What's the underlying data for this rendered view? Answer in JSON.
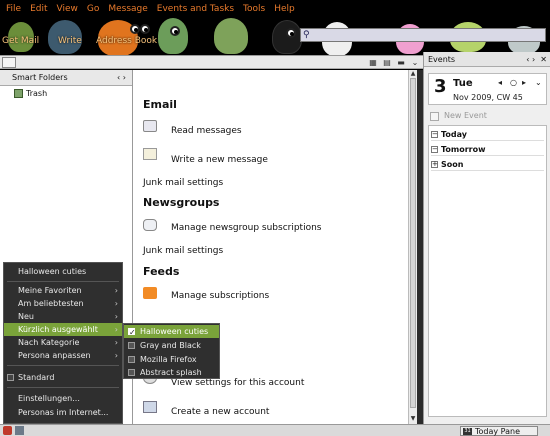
{
  "menubar": {
    "items": [
      "File",
      "Edit",
      "View",
      "Go",
      "Message",
      "Events and Tasks",
      "Tools",
      "Help"
    ]
  },
  "toolbar": {
    "get_mail": "Get Mail",
    "write": "Write",
    "address_book": "Address Book"
  },
  "folder_pane": {
    "header": "Smart Folders",
    "folders": [
      "Trash"
    ]
  },
  "main": {
    "sections": [
      {
        "title": "Email"
      },
      {
        "title": "Newsgroups"
      },
      {
        "title": "Feeds"
      }
    ],
    "actions": {
      "read_messages": "Read messages",
      "write_message": "Write a new message",
      "junk_mail_1": "Junk mail settings",
      "manage_newsgroups": "Manage newsgroup subscriptions",
      "junk_mail_2": "Junk mail settings",
      "manage_subscriptions": "Manage subscriptions",
      "view_settings": "View settings for this account",
      "create_account": "Create a new account"
    }
  },
  "events": {
    "header": "Events",
    "day_number": "3",
    "day_name": "Tue",
    "day_sub": "Nov 2009, CW 45",
    "new_event": "New Event",
    "agenda": [
      "Today",
      "Tomorrow",
      "Soon"
    ]
  },
  "statusbar": {
    "today_pane": "Today Pane",
    "today_icon": "31"
  },
  "persona_menu": {
    "items": [
      {
        "label": "Halloween cuties",
        "arrow": ""
      },
      {
        "label": "Meine Favoriten",
        "arrow": "›"
      },
      {
        "label": "Am beliebtesten",
        "arrow": "›"
      },
      {
        "label": "Neu",
        "arrow": "›"
      },
      {
        "label": "Kürzlich ausgewählt",
        "arrow": "›"
      },
      {
        "label": "Nach Kategorie",
        "arrow": "›"
      },
      {
        "label": "Persona anpassen",
        "arrow": "›"
      },
      {
        "label": "Standard",
        "arrow": ""
      },
      {
        "label": "Einstellungen...",
        "arrow": ""
      },
      {
        "label": "Personas im Internet...",
        "arrow": ""
      }
    ]
  },
  "sub_menu": {
    "items": [
      "Halloween cuties",
      "Gray and Black",
      "Mozilla Firefox",
      "Abstract splash"
    ]
  },
  "colors": {
    "accent": "#e87a2c",
    "menu_highlight": "#7aa33a",
    "theme_bg": "#000000"
  },
  "icons": [
    "search-icon",
    "trash-icon",
    "read-messages-icon",
    "write-message-icon",
    "newsgroup-icon",
    "rss-feed-icon",
    "settings-icon",
    "new-account-icon",
    "calendar-icon",
    "check-icon"
  ]
}
